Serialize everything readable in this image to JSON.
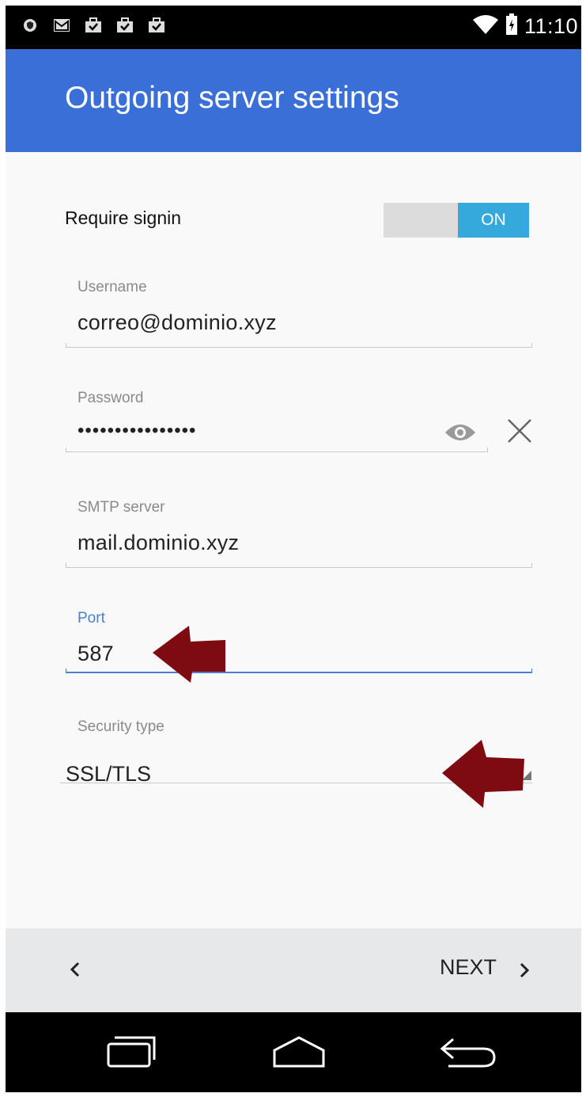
{
  "status_bar": {
    "time": "11:10",
    "icons_left": [
      "shield-icon",
      "gmail-icon",
      "briefcase-check-icon",
      "briefcase-check-icon",
      "briefcase-check-icon"
    ],
    "icons_right": [
      "wifi-icon",
      "battery-icon"
    ]
  },
  "app_bar": {
    "title": "Outgoing server settings",
    "color": "#3a6fd8"
  },
  "require_signin": {
    "label": "Require signin",
    "toggle_state": "ON",
    "toggle_color": "#35a9dc"
  },
  "fields": {
    "username": {
      "label": "Username",
      "value": "correo@dominio.xyz"
    },
    "password": {
      "label": "Password",
      "value": "••••••••••••••••"
    },
    "smtp_server": {
      "label": "SMTP server",
      "value": "mail.dominio.xyz"
    },
    "port": {
      "label": "Port",
      "value": "587"
    },
    "security_type": {
      "label": "Security type",
      "value": "SSL/TLS"
    }
  },
  "footer": {
    "next_label": "NEXT"
  },
  "annotation_color": "#7e0b12"
}
